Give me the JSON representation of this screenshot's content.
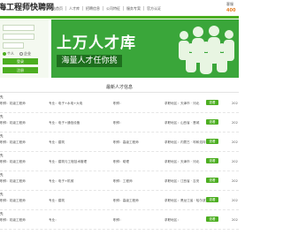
{
  "header": {
    "logo": "海工程师快聘网",
    "logo_sub": "",
    "nav": [
      "网站首页",
      "人才库",
      "招聘信息",
      "公司特征",
      "服务专案",
      "官方认证"
    ],
    "hotline_label": "客服",
    "hotline_number": "400"
  },
  "login": {
    "radio_person": "个人",
    "radio_company": "企业",
    "login_button": "登录",
    "register_button": "注册"
  },
  "banner": {
    "title": "上万人才库",
    "subtitle": "海量人才任你挑"
  },
  "section": {
    "title": "最新人才信息"
  },
  "rows": [
    {
      "type": "先",
      "c1": "职称：初级工程师",
      "c2": "专业：电子+水电+大电",
      "c3": "职称：",
      "c4": "求职地区：天津市 · 河北",
      "button": "查看",
      "date": "202"
    },
    {
      "type": "先",
      "c1": "职称：初级工程师",
      "c2": "专业：电子+通信设备",
      "c3": "职称：",
      "c4": "求职地区：山西省 · 晋城",
      "button": "查看",
      "date": "202"
    },
    {
      "type": "先",
      "c1": "职称：初级工程师",
      "c2": "专业：建筑",
      "c3": "职称：高级工程师",
      "c4": "求职地区：内蒙古 · 呼和浩特",
      "button": "查看",
      "date": "202"
    },
    {
      "type": "先",
      "c1": "职称：初级工程师",
      "c2": "专业：建筑与工程技术管理",
      "c3": "职称：助理",
      "c4": "求职地区：天津市 · 河北",
      "button": "查看",
      "date": "202"
    },
    {
      "type": "先",
      "c1": "职称：初级工程师",
      "c2": "专业：电子+机械",
      "c3": "职称：工程师",
      "c4": "求职地区：江西省 · 吉安",
      "button": "查看",
      "date": "202"
    },
    {
      "type": "先",
      "c1": "职称：初级工程师",
      "c2": "专业：建筑",
      "c3": "职称：高级工程师",
      "c4": "求职地区：黑龙江省 · 哈尔滨",
      "button": "查看",
      "date": "202"
    },
    {
      "type": "先",
      "c1": "职称：初级工程师",
      "c2": "专业：",
      "c3": "职称：",
      "c4": "求职地区：",
      "button": "查看",
      "date": "202"
    }
  ]
}
